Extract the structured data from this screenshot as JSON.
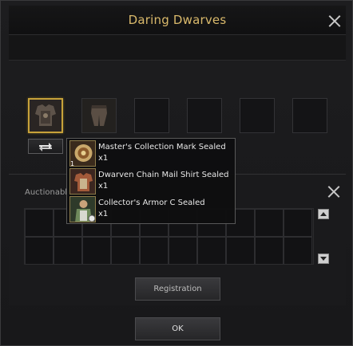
{
  "window": {
    "title": "Daring Dwarves"
  },
  "registration_section": {
    "label": "Auctionable"
  },
  "buttons": {
    "registration": "Registration",
    "ok": "OK"
  },
  "tooltip": {
    "items": [
      {
        "name": "Master's Collection Mark Sealed",
        "qty": "x1",
        "count": "1",
        "icon": "collection-mark-icon"
      },
      {
        "name": "Dwarven Chain Mail Shirt Sealed",
        "qty": "x1",
        "icon": "chain-mail-shirt-icon"
      },
      {
        "name": "Collector's Armor C Sealed",
        "qty": "x1",
        "icon": "collector-armor-icon"
      }
    ]
  },
  "colors": {
    "title": "#d9b96b",
    "selected_border": "#c7a23a"
  }
}
